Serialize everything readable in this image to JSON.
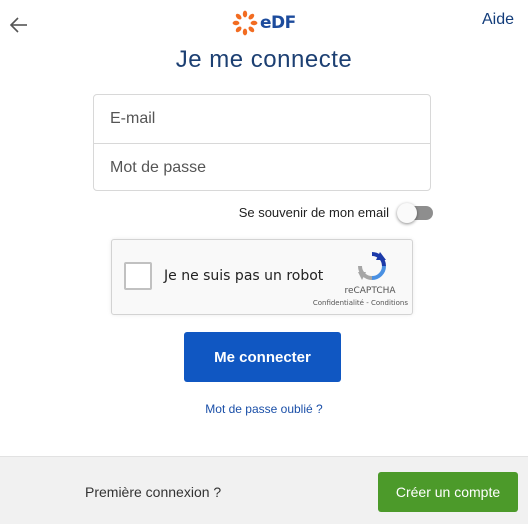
{
  "header": {
    "back_icon": "arrow-left-icon",
    "logo_text": "eDF",
    "logo_icon": "edf-sun-logo",
    "help_label": "Aide",
    "title": "Je me connecte"
  },
  "form": {
    "email_placeholder": "E-mail",
    "password_placeholder": "Mot de passe",
    "remember_label": "Se souvenir de mon email",
    "remember_checked": false
  },
  "captcha": {
    "label": "Je ne suis pas un robot",
    "brand": "reCAPTCHA",
    "links": "Confidentialité - Conditions"
  },
  "actions": {
    "login_label": "Me connecter",
    "forgot_label": "Mot de passe oublié ?"
  },
  "footer": {
    "first_login_label": "Première connexion ?",
    "create_account_label": "Créer un compte"
  },
  "colors": {
    "primary_blue": "#1057c2",
    "create_green": "#4c9a2a",
    "logo_orange": "#f26c21",
    "logo_blue": "#1c4b9c"
  }
}
